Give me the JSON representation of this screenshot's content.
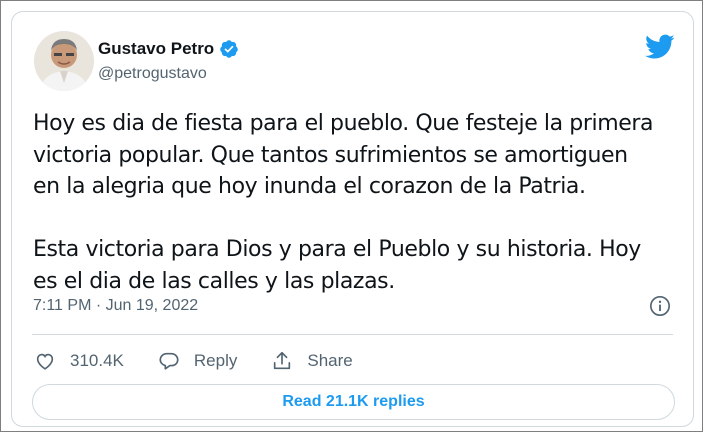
{
  "author": {
    "name": "Gustavo Petro",
    "handle": "@petrogustavo",
    "verified": true
  },
  "tweet": {
    "paragraph1": [
      "Hoy es dia de fiesta para el pueblo. Que festeje la primera",
      "victoria popular. Que tantos sufrimientos se amortiguen",
      "en la alegria que hoy inunda el corazon de la Patria."
    ],
    "paragraph2": [
      "Esta victoria para Dios y para el Pueblo y su historia. Hoy",
      "es el dia de las calles y las plazas."
    ],
    "timestamp": "7:11 PM · Jun 19, 2022"
  },
  "actions": {
    "like_count": "310.4K",
    "reply_label": "Reply",
    "share_label": "Share"
  },
  "read_replies_label": "Read 21.1K replies",
  "colors": {
    "accent": "#1d9bf0",
    "text": "#0f1419",
    "secondary": "#536471",
    "border": "#cfd9de"
  },
  "icons": [
    "avatar",
    "verified-badge-icon",
    "twitter-bird-icon",
    "info-icon",
    "heart-icon",
    "reply-icon",
    "share-icon"
  ]
}
